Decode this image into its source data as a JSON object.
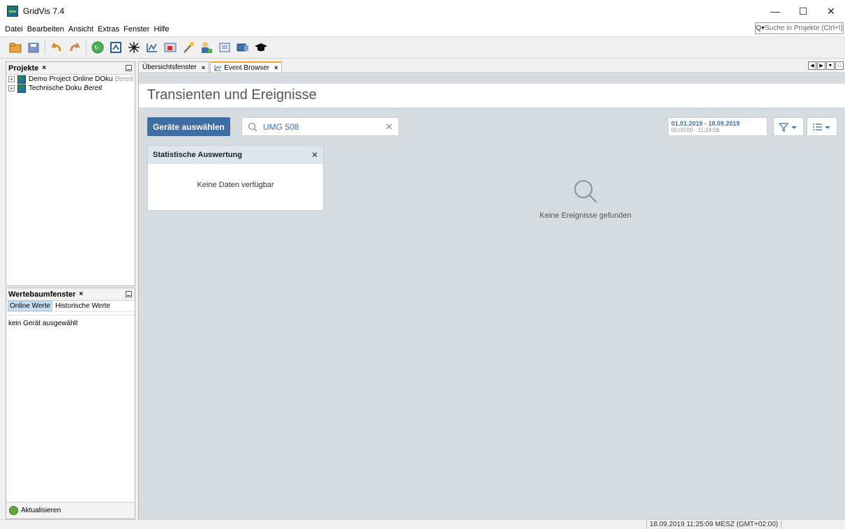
{
  "window": {
    "title": "GridVis 7.4"
  },
  "menu": {
    "items": [
      "Datei",
      "Bearbeiten",
      "Ansicht",
      "Extras",
      "Fenster",
      "Hilfe"
    ]
  },
  "search": {
    "placeholder": "Suche in Projekte (Ctrl+I)"
  },
  "toolbar": {
    "icons": [
      "open-project-icon",
      "save-icon",
      "undo-icon",
      "redo-icon",
      "sync-icon",
      "import-icon",
      "topology-icon",
      "graph-icon",
      "event-icon",
      "wizard-icon",
      "user-icon",
      "report-icon",
      "device-icon",
      "academy-icon"
    ]
  },
  "projects_panel": {
    "title": "Projekte",
    "projects": [
      {
        "name": "Demo Project Online DOku",
        "status": "Bereit"
      },
      {
        "name": "Technische Doku",
        "status": "Bereit"
      }
    ]
  },
  "values_panel": {
    "title": "Wertebaumfenster",
    "tabs": [
      "Online Werte",
      "Historische Werte"
    ],
    "empty_text": "kein Gerät ausgewählt",
    "refresh_label": "Aktualisieren"
  },
  "doc_tabs": [
    {
      "label": "Übersichtsfenster",
      "active": false
    },
    {
      "label": "Event Browser",
      "active": true
    }
  ],
  "main": {
    "title": "Transienten und Ereignisse",
    "select_devices_label": "Geräte auswählen",
    "search_value": "UMG 508",
    "date_range": "01.01.2019 - 18.09.2019",
    "time_range": "00:00:00 - 11:24:58",
    "stats_card": {
      "title": "Statistische Auswertung",
      "empty_text": "Keine Daten verfügbar"
    },
    "empty_state": "Keine Ereignisse gefunden"
  },
  "status_bar": {
    "clock": "18.09.2019 11:25:09 MESZ (GMT+02:00)"
  },
  "colors": {
    "accent": "#3e6ea4",
    "content_bg": "#d6dbe0",
    "tab_highlight": "#f5a623"
  }
}
